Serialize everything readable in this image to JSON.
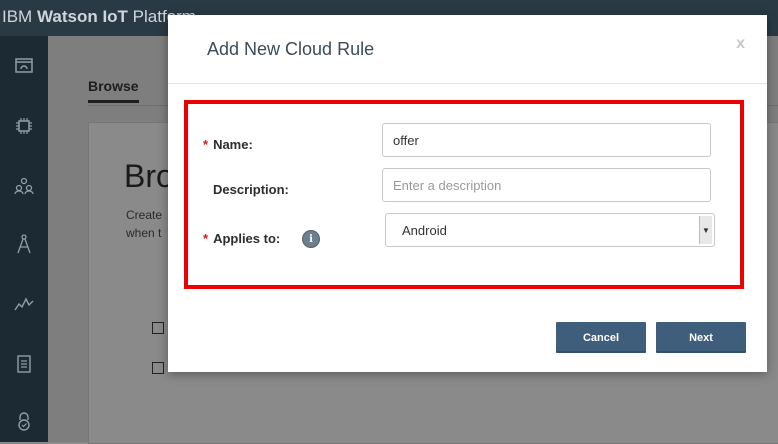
{
  "app": {
    "title_prefix": "IBM",
    "title_bold": "Watson IoT",
    "title_suffix": "Platform"
  },
  "sidebar": {
    "icons": [
      "dashboard-icon",
      "chip-icon",
      "members-icon",
      "compass-icon",
      "analytics-icon",
      "document-icon",
      "lock-icon"
    ]
  },
  "background": {
    "tab_browse": "Browse",
    "heading": "Bro",
    "sub_line1": "Create",
    "sub_line2": "when t"
  },
  "modal": {
    "title": "Add New Cloud Rule",
    "close_label": "x",
    "required_marker": "*",
    "name_label": "Name:",
    "name_value": "offer",
    "description_label": "Description:",
    "description_placeholder": "Enter a description",
    "applies_label": "Applies to:",
    "info_glyph": "i",
    "applies_value": "Android",
    "cancel_label": "Cancel",
    "next_label": "Next"
  },
  "colors": {
    "highlight_border": "#ef0000",
    "primary_button": "#3f5e7c",
    "required_star": "#d01a1a"
  }
}
